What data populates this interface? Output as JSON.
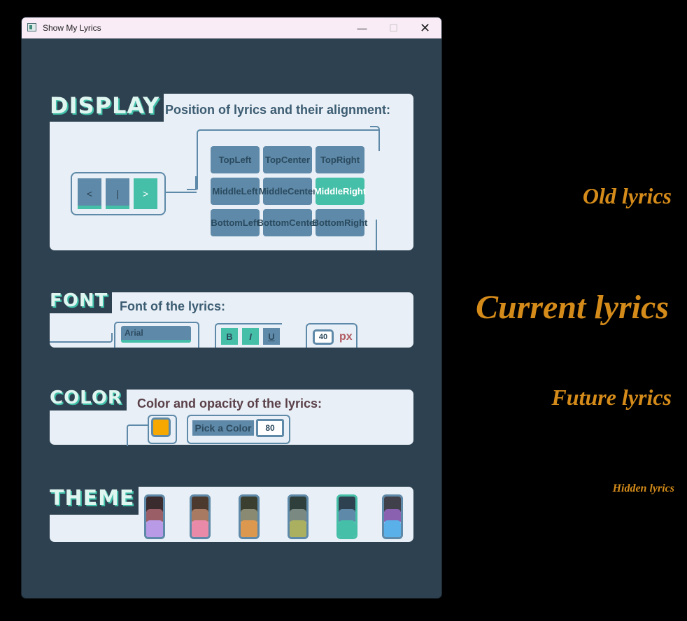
{
  "window": {
    "title": "Show My Lyrics",
    "controls": {
      "minimize": "—",
      "maximize": "☐",
      "close": "✕"
    }
  },
  "display": {
    "label": "DISPLAY",
    "heading": "Position of lyrics and their alignment:",
    "alignment_buttons": [
      "<",
      "|",
      ">"
    ],
    "active_alignment": ">",
    "positions": [
      [
        "Top",
        "Left"
      ],
      [
        "Top",
        "Center"
      ],
      [
        "Top",
        "Right"
      ],
      [
        "Middle",
        "Left"
      ],
      [
        "Middle",
        "Center"
      ],
      [
        "Middle",
        "Right"
      ],
      [
        "Bottom",
        "Left"
      ],
      [
        "Bottom",
        "Center"
      ],
      [
        "Bottom",
        "Right"
      ]
    ],
    "active_position": "Middle Right"
  },
  "font": {
    "label": "FONT",
    "heading": "Font of the lyrics:",
    "family": "Arial",
    "bold": "B",
    "italic": "I",
    "underline": "U",
    "size": "40",
    "unit": "px"
  },
  "color": {
    "label": "COLOR",
    "heading": "Color and opacity of the lyrics:",
    "swatch": "#f6a800",
    "pick_label": "Pick a Color",
    "opacity": "80"
  },
  "theme": {
    "label": "THEME",
    "options": [
      {
        "c1": "#3a2b2f",
        "c2": "#9a5e66",
        "c3": "#b89ae6"
      },
      {
        "c1": "#4d3a2f",
        "c2": "#a87a62",
        "c3": "#e88aa8"
      },
      {
        "c1": "#3a3f30",
        "c2": "#8a8a72",
        "c3": "#dd9850"
      },
      {
        "c1": "#2e3f3c",
        "c2": "#7a8a82",
        "c3": "#aab060"
      },
      {
        "c1": "#2e4150",
        "c2": "#5e89a8",
        "c3": "#46bfa8"
      },
      {
        "c1": "#40404a",
        "c2": "#8a60b0",
        "c3": "#5ab0e8"
      }
    ],
    "active_index": 4
  },
  "lyrics": {
    "old": "Old lyrics",
    "current": "Current lyrics",
    "future": "Future lyrics",
    "hidden": "Hidden lyrics",
    "color": "#d48b1a"
  }
}
